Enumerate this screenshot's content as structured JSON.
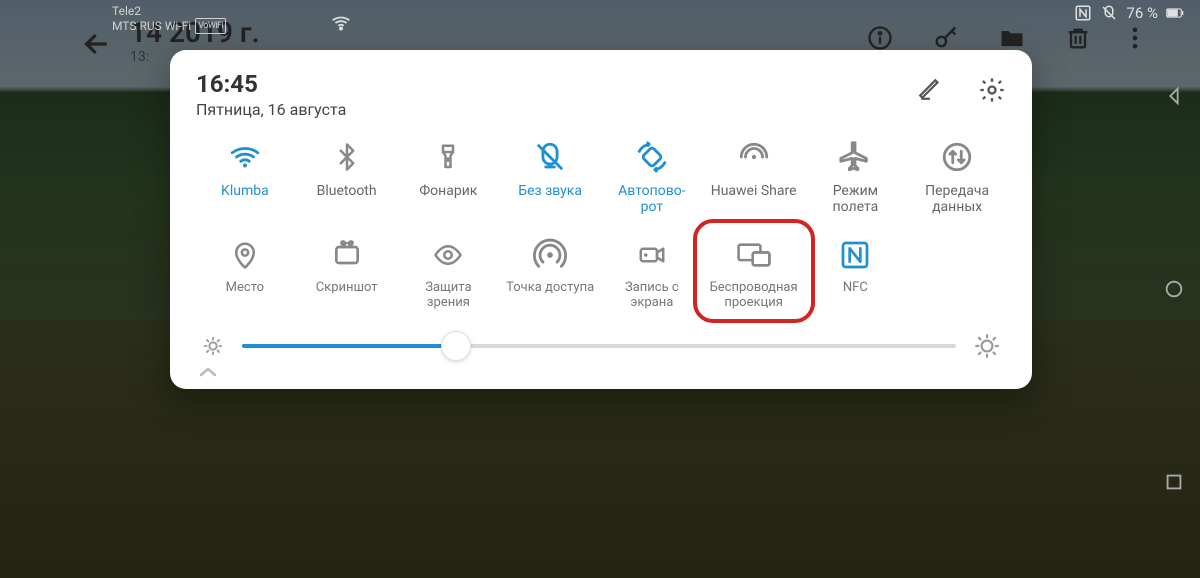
{
  "status": {
    "carrier1": "Tele2",
    "carrier2": "MTS RUS Wi-Fi",
    "vowifi_badge": "VoWiFi",
    "nfc_icon_label": "N",
    "battery_pct": "76 %"
  },
  "gallery": {
    "date_partial": "14          2019 г.",
    "time_partial": "13:"
  },
  "panel": {
    "time": "16:45",
    "date": "Пятница, 16 августа"
  },
  "qs": [
    {
      "label": "Klumba",
      "icon": "wifi",
      "active": true
    },
    {
      "label": "Bluetooth",
      "icon": "bluetooth",
      "active": false
    },
    {
      "label": "Фонарик",
      "icon": "flashlight",
      "active": false
    },
    {
      "label": "Без звука",
      "icon": "mute",
      "active": true
    },
    {
      "label": "Автоповорот",
      "icon": "autorotate",
      "active": true
    },
    {
      "label": "Huawei Share",
      "icon": "share",
      "active": false
    },
    {
      "label": "Режим полета",
      "icon": "airplane",
      "active": false
    },
    {
      "label": "Передача данных",
      "icon": "data",
      "active": false
    },
    {
      "label": "Место",
      "icon": "location",
      "active": false
    },
    {
      "label": "Скриншот",
      "icon": "screenshot",
      "active": false
    },
    {
      "label": "Защита зрения",
      "icon": "eye",
      "active": false
    },
    {
      "label": "Точка доступа",
      "icon": "hotspot",
      "active": false
    },
    {
      "label": "Запись с экрана",
      "icon": "record",
      "active": false
    },
    {
      "label": "Беспроводная проекция",
      "icon": "cast",
      "active": false,
      "highlighted": true
    },
    {
      "label": "NFC",
      "icon": "nfc",
      "active": true
    }
  ],
  "brightness": {
    "percent": 30
  }
}
